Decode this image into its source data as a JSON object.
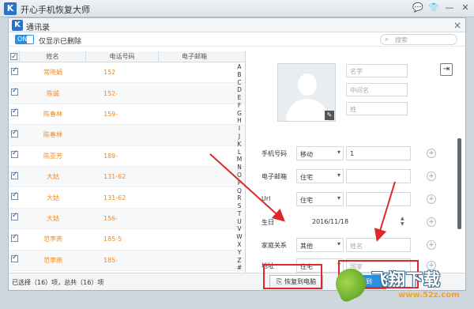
{
  "app": {
    "logo": "K",
    "title": "开心手机恢复大师",
    "controls": [
      "chat-icon",
      "shirt-icon",
      "minimize-icon",
      "close-icon"
    ]
  },
  "dialog": {
    "logo": "K",
    "title": "通讯录",
    "close": "×",
    "toggle_label": "ON",
    "filter_label": "仅显示已删除",
    "search_placeholder": "搜索"
  },
  "table": {
    "headers": [
      "姓名",
      "电话号码",
      "电子邮箱"
    ],
    "rows": [
      {
        "name": "常晓娟",
        "phone": "152"
      },
      {
        "name": "陈诚",
        "phone": "152-"
      },
      {
        "name": "陈春林",
        "phone": "159-"
      },
      {
        "name": "陈春林",
        "phone": ""
      },
      {
        "name": "陈亚芳",
        "phone": "189-"
      },
      {
        "name": "大姑",
        "phone": "131-62"
      },
      {
        "name": "大姑",
        "phone": "131-62"
      },
      {
        "name": "大姑",
        "phone": "156-"
      },
      {
        "name": "范李燕",
        "phone": "185-5"
      },
      {
        "name": "范李燕",
        "phone": "185-"
      }
    ],
    "alphabet": [
      "A",
      "B",
      "C",
      "D",
      "E",
      "F",
      "G",
      "H",
      "I",
      "J",
      "K",
      "L",
      "M",
      "N",
      "O",
      "P",
      "Q",
      "R",
      "S",
      "T",
      "U",
      "V",
      "W",
      "X",
      "Y",
      "Z",
      "#"
    ]
  },
  "detail": {
    "placeholders": {
      "first": "名字",
      "middle": "中间名",
      "last": "姓"
    },
    "fields": {
      "phone": {
        "label": "手机号码",
        "type": "移动",
        "value": "1"
      },
      "email": {
        "label": "电子邮箱",
        "type": "住宅",
        "value": ""
      },
      "url": {
        "label": "Url",
        "type": "住宅",
        "value": ""
      },
      "birthday": {
        "label": "生日",
        "value": "2016/11/18"
      },
      "relation": {
        "label": "家庭关系",
        "type": "其他",
        "placeholder": "姓名"
      },
      "address": {
        "label": "地址",
        "type": "住宅",
        "placeholder": "国家"
      }
    }
  },
  "bottom": {
    "status": "已选择（16）项，总共（16）项",
    "restore_to_pc": "恢复到电脑",
    "restore_to_device": "恢复到"
  },
  "watermark": {
    "main": "飞翔下载",
    "sub": "www.52z.com"
  }
}
